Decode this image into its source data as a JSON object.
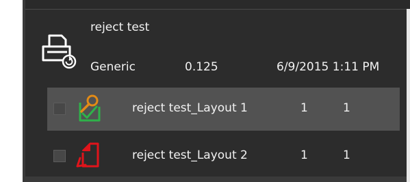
{
  "job": {
    "name": "reject test",
    "type": "Generic",
    "size": "0.125",
    "date": "6/9/2015 1:11 PM",
    "icon": "print-job-icon"
  },
  "layouts": [
    {
      "label": "reject test_Layout 1",
      "col1": "1",
      "col2": "1",
      "icon": "layout-approved-icon",
      "selected": true,
      "checked": false
    },
    {
      "label": "reject test_Layout 2",
      "col1": "1",
      "col2": "1",
      "icon": "layout-rejected-icon",
      "selected": false,
      "checked": false
    }
  ],
  "colors": {
    "panel": "#2c2c2c",
    "row_selected": "#525252",
    "approved": "#2fb24a",
    "magnifier": "#e38b16",
    "rejected": "#e0141b"
  }
}
